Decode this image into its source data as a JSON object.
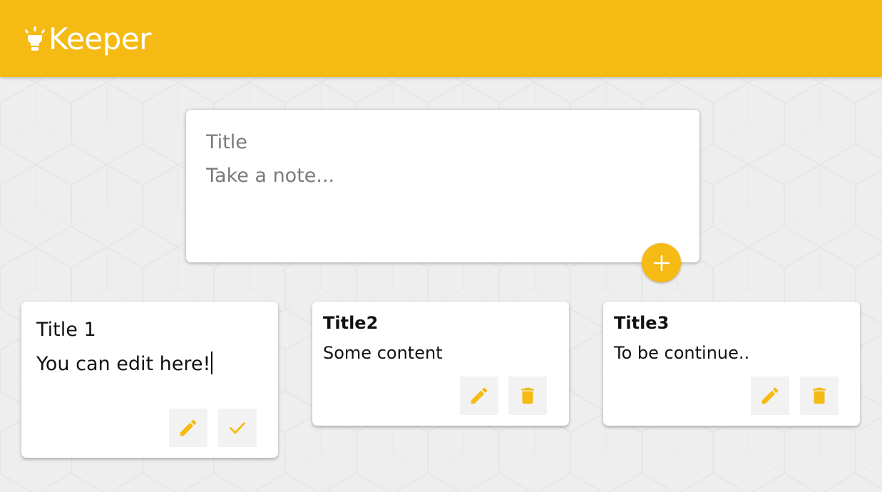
{
  "app": {
    "name": "Keeper",
    "brand_color": "#f5ba13",
    "logo_icon": "lightbulb-icon"
  },
  "create_note": {
    "title_placeholder": "Title",
    "content_placeholder": "Take a note...",
    "add_icon": "plus-icon"
  },
  "notes": [
    {
      "title": "Title 1",
      "content": "You can edit here!",
      "mode": "editing",
      "actions": [
        "edit-icon",
        "check-icon"
      ]
    },
    {
      "title": "Title2",
      "content": "Some content",
      "mode": "view",
      "actions": [
        "edit-icon",
        "delete-icon"
      ]
    },
    {
      "title": "Title3",
      "content": "To be continue..",
      "mode": "view",
      "actions": [
        "edit-icon",
        "delete-icon"
      ]
    }
  ]
}
